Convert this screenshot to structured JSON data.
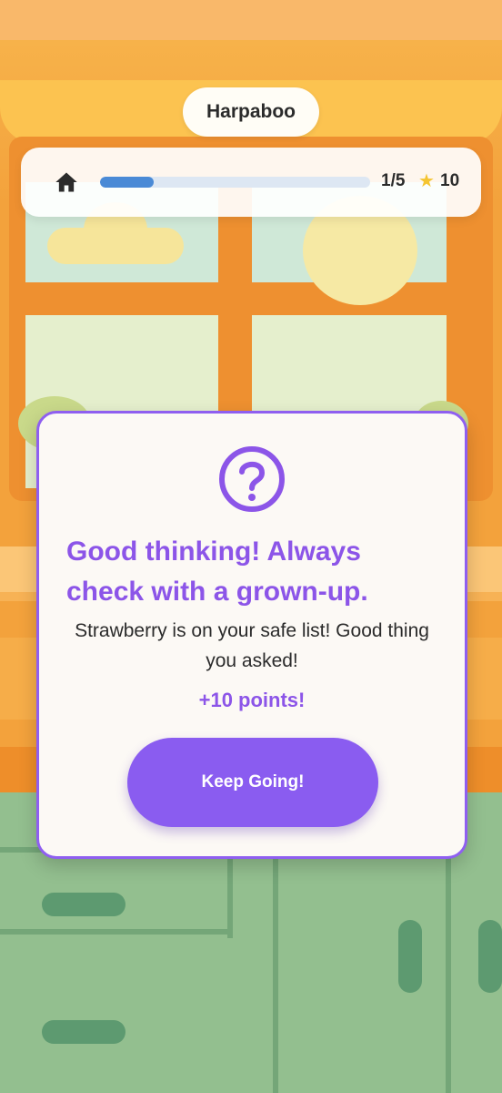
{
  "player": {
    "name": "Harpaboo"
  },
  "hud": {
    "home_icon": "home-icon",
    "progress_text": "1/5",
    "progress_fraction": 0.2,
    "star_icon": "star-icon",
    "score": "10",
    "colors": {
      "progress_fill": "#4a8ad6",
      "progress_track": "#dde7f3"
    }
  },
  "feedback": {
    "icon": "question-circle-icon",
    "title": "Good thinking! Always check with a grown-up.",
    "message": "Strawberry is on your safe list! Good thing you asked!",
    "points": "+10 points!",
    "button_label": "Keep Going!",
    "colors": {
      "accent": "#8c55e8",
      "button": "#8a5cf0",
      "border": "#8f5ff0"
    }
  }
}
